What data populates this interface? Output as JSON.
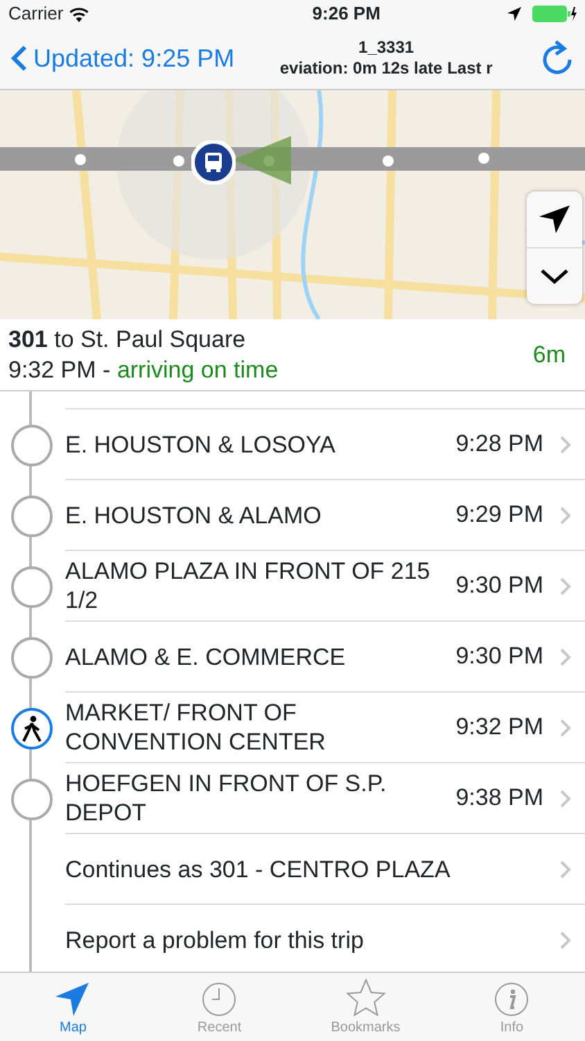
{
  "status_bar": {
    "carrier": "Carrier",
    "time": "9:26 PM"
  },
  "nav_bar": {
    "back_label": "Updated: 9:25 PM",
    "title": "1_3331",
    "subtitle": "eviation: 0m 12s late  Last r"
  },
  "trip": {
    "route": "301",
    "destination": "to St. Paul Square",
    "time": "9:32 PM -",
    "status": "arriving on time",
    "countdown": "6m"
  },
  "stops": [
    {
      "kind": "stop",
      "name": "E. HOUSTON & LOSOYA",
      "time": "9:28 PM"
    },
    {
      "kind": "stop",
      "name": "E. HOUSTON & ALAMO",
      "time": "9:29 PM"
    },
    {
      "kind": "stop",
      "name": "ALAMO PLAZA IN FRONT OF 215 1/2",
      "time": "9:30 PM"
    },
    {
      "kind": "stop",
      "name": "ALAMO & E. COMMERCE",
      "time": "9:30 PM"
    },
    {
      "kind": "current",
      "name": "MARKET/ FRONT OF CONVENTION CENTER",
      "time": "9:32 PM"
    },
    {
      "kind": "stop",
      "name": "HOEFGEN IN FRONT OF S.P. DEPOT",
      "time": "9:38 PM"
    }
  ],
  "actions": [
    "Continues as 301 - CENTRO PLAZA",
    "Report a problem for this trip"
  ],
  "tabs": [
    {
      "label": "Map",
      "selected": true
    },
    {
      "label": "Recent",
      "selected": false
    },
    {
      "label": "Bookmarks",
      "selected": false
    },
    {
      "label": "Info",
      "selected": false
    }
  ]
}
